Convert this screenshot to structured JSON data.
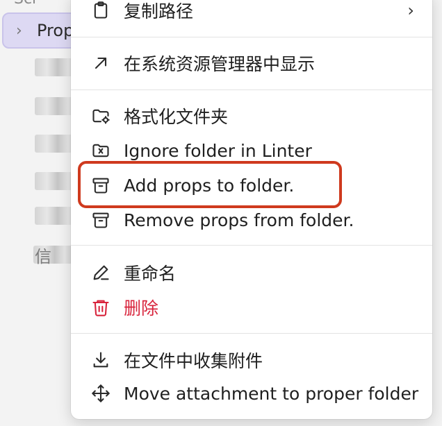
{
  "sidebar": {
    "top_item_label": "Scr",
    "selected_label": "Prop",
    "selected_chevron": "chevron-right-icon",
    "tail_char": "信"
  },
  "menu": {
    "copy_path": {
      "label": "复制路径",
      "icon": "clipboard-icon"
    },
    "show_in_explorer": {
      "label": "在系统资源管理器中显示",
      "icon": "arrow-up-right-icon"
    },
    "format_folder": {
      "label": "格式化文件夹",
      "icon": "folder-gear-icon"
    },
    "ignore_folder": {
      "label": "Ignore folder in Linter",
      "icon": "folder-x-icon"
    },
    "add_props": {
      "label": "Add props to folder.",
      "icon": "archive-icon"
    },
    "remove_props": {
      "label": "Remove props from folder.",
      "icon": "archive-icon"
    },
    "rename": {
      "label": "重命名",
      "icon": "pencil-icon"
    },
    "delete": {
      "label": "删除",
      "icon": "trash-icon"
    },
    "collect_attachments": {
      "label": "在文件中收集附件",
      "icon": "download-icon"
    },
    "move_attachment": {
      "label": "Move attachment to proper folder",
      "icon": "move-icon"
    }
  },
  "colors": {
    "danger": "#d8243c",
    "highlight": "#cf3a1e",
    "selected_bg": "#ddd9f3"
  }
}
